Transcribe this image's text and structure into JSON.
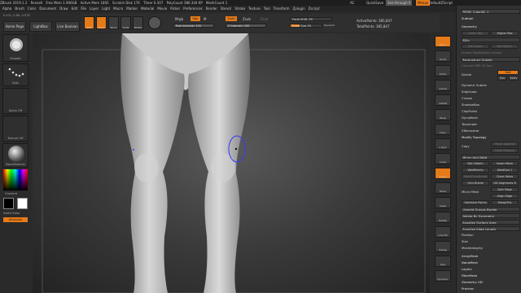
{
  "titlebar": {
    "items": [
      "ZBrush 2019.1.2",
      "Renzell",
      "Free Mem 1.906GB",
      "Active Mem 1805",
      "Scratch Disk 176",
      "Timer 0.307",
      "PolyCount 386.344 KP",
      "MeshCount 1"
    ],
    "right": [
      "AC",
      "QuickSave",
      "See-through 0",
      "Menus",
      "DefaultZScript"
    ]
  },
  "menubar": [
    "Alpha",
    "Brush",
    "Color",
    "Document",
    "Draw",
    "Edit",
    "File",
    "Layer",
    "Light",
    "Macro",
    "Marker",
    "Material",
    "Movie",
    "Picker",
    "Preferences",
    "Render",
    "Stencil",
    "Stroke",
    "Texture",
    "Tool",
    "Transform",
    "Zplugin",
    "Zscript"
  ],
  "coords": "0.431,-0.86,-0.078",
  "lightbox": {
    "home": "Home Page",
    "lightbox": "LightBox",
    "live_boolean": "Live Boolean"
  },
  "toolbar": {
    "edit": "Edit",
    "draw": "Draw",
    "move": "Move",
    "scale": "Scale",
    "rotate": "Rotate",
    "mrgb": "Mrgb",
    "rgb": "Rgb",
    "m": "M",
    "rgb_intensity": "Rgb Intensity 100",
    "zadd": "Zadd",
    "zsub": "Zsub",
    "zcut": "Zcut",
    "z_intensity": "Z Intensity 100",
    "focal_shift": "Focal Shift -55",
    "draw_size": "Draw Size 59",
    "dynamic": "Dynamic",
    "active_points": "ActivePoints: 385,847",
    "total_points": "TotalPoints: 385,847"
  },
  "leftshelf": {
    "brush": "Smooth",
    "stroke": "Dots",
    "alpha": "Alpha Off",
    "texture": "Texture Off",
    "material": "BasicMaterial",
    "gradient": "Gradient",
    "switch": "SwitchColor",
    "alternate": "Alternate"
  },
  "rightshelf": [
    "SPix 3",
    "Scroll",
    "Zoom",
    "Actual",
    "AAHalf",
    "Persp",
    "Floor",
    "L.Sym",
    "Local",
    "Frame",
    "Move",
    "Scale",
    "Rotate",
    "Line Fill",
    "Transp",
    "Solo",
    "Dynamic"
  ],
  "panel": {
    "top": "PM3D_Cube3D_1",
    "subtool": "Subtool",
    "geometry": "Geometry",
    "lower_res": "Lower Res",
    "higher_res": "Higher Res",
    "sdiv": "SDiv",
    "del_lower": "Del Lower",
    "del_higher": "Del Higher",
    "freeze": "Freeze SubDivision Levels",
    "reconstruct": "Reconstruct Subdiv",
    "convert": "Convert BPR To Geo",
    "divide": "Divide",
    "smt": "Smt",
    "suv": "Suv",
    "relly": "ReUV",
    "dynamic_sub": "Dynamic Subdiv",
    "edgeloop": "EdgeLoop",
    "crease": "Crease",
    "shadowbox": "ShadowBox",
    "claypolish": "ClayPolish",
    "dynamesh": "DynaMesh",
    "tessimate": "Tessimate",
    "zremesher": "ZRemesher",
    "modify_topology": "Modify Topology",
    "copy": "Copy",
    "paste_append": "Paste Append",
    "paste_replace": "Paste Replace",
    "mirror_weld": "Mirror And Weld",
    "del_hidden": "Del Hidden",
    "insert_mesh": "Insert Mesh",
    "weldpoints": "WeldPoints",
    "weld_dist": "WeldDist 1",
    "mesh_from_brush": "MeshFromBrush",
    "close_holes": "Close Holes",
    "grid_divide": "Grid Divide",
    "gd_segments": "GD Segments 8",
    "micro_mesh": "Micro Mesh",
    "spin_edge": "Spin Edge",
    "align_edge": "Align Edge",
    "optimize_points": "Optimize Points",
    "mergetris": "MergeTris",
    "unweld_groups": "Unweld Groups Border",
    "delete_symmetry": "Delete By Symmetry",
    "equalize_area": "Equalize Surface Area",
    "equalize_edge": "Equalize Edge Length",
    "position": "Position",
    "size": "Size",
    "meshintegrity": "MeshIntegrity",
    "arraymesh": "ArrayMesh",
    "nanomesh": "NanoMesh",
    "layers": "Layers",
    "fibermesh": "FiberMesh",
    "geometry_hd": "Geometry HD",
    "preview": "Preview"
  },
  "colors": {
    "accent": "#e57a19",
    "brush_ring": "#3a3aff"
  }
}
